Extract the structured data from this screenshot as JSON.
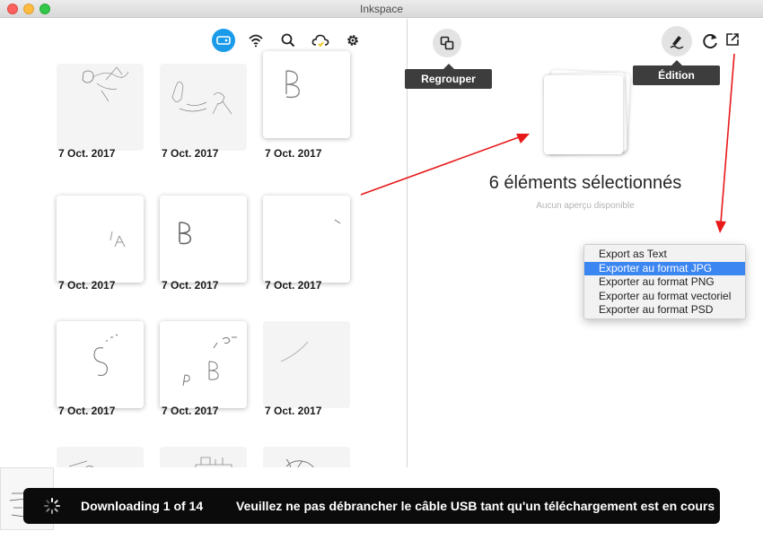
{
  "window": {
    "title": "Inkspace"
  },
  "toolbar_left": {
    "icons": [
      "device-icon",
      "wifi-icon",
      "search-icon",
      "cloud-sync-icon",
      "gear-icon"
    ]
  },
  "gallery": {
    "items": [
      {
        "date": "7 Oct. 2017",
        "style": "flat",
        "art": "fairy-sketch"
      },
      {
        "date": "7 Oct. 2017",
        "style": "flat",
        "art": "figures-sketch"
      },
      {
        "date": "7 Oct. 2017",
        "style": "raised",
        "art": "letter-b"
      },
      {
        "date": "7 Oct. 2017",
        "style": "raised",
        "art": "letter-a"
      },
      {
        "date": "7 Oct. 2017",
        "style": "raised",
        "art": "letter-b-large"
      },
      {
        "date": "7 Oct. 2017",
        "style": "raised",
        "art": "stroke"
      },
      {
        "date": "7 Oct. 2017",
        "style": "raised",
        "art": "letter-s"
      },
      {
        "date": "7 Oct. 2017",
        "style": "raised",
        "art": "calligraphy-b"
      },
      {
        "date": "7 Oct. 2017",
        "style": "flat",
        "art": "curve"
      },
      {
        "date": "",
        "style": "flat",
        "art": "text-sketch"
      },
      {
        "date": "",
        "style": "flat",
        "art": "building-sketch"
      },
      {
        "date": "",
        "style": "flat",
        "art": "tree-sketch"
      }
    ]
  },
  "right_pane": {
    "group_tooltip": "Regrouper",
    "edit_tooltip": "Édition",
    "selection_title": "6 éléments sélectionnés",
    "selection_subtitle": "Aucun aperçu disponible"
  },
  "export_menu": {
    "items": [
      {
        "label": "Export as Text",
        "highlighted": false
      },
      {
        "label": "Exporter au format JPG",
        "highlighted": true
      },
      {
        "label": "Exporter au format PNG",
        "highlighted": false
      },
      {
        "label": "Exporter au format vectoriel",
        "highlighted": false
      },
      {
        "label": "Exporter au format PSD",
        "highlighted": false
      }
    ]
  },
  "toast": {
    "progress_text": "Downloading 1 of 14",
    "message": "Veuillez ne pas débrancher le câble USB tant qu'un téléchargement est en cours"
  },
  "colors": {
    "accent": "#1a9bea",
    "menu_highlight": "#3c86f2",
    "annotation_arrow": "#e8191a",
    "toast_bg": "#0b0b0b"
  }
}
